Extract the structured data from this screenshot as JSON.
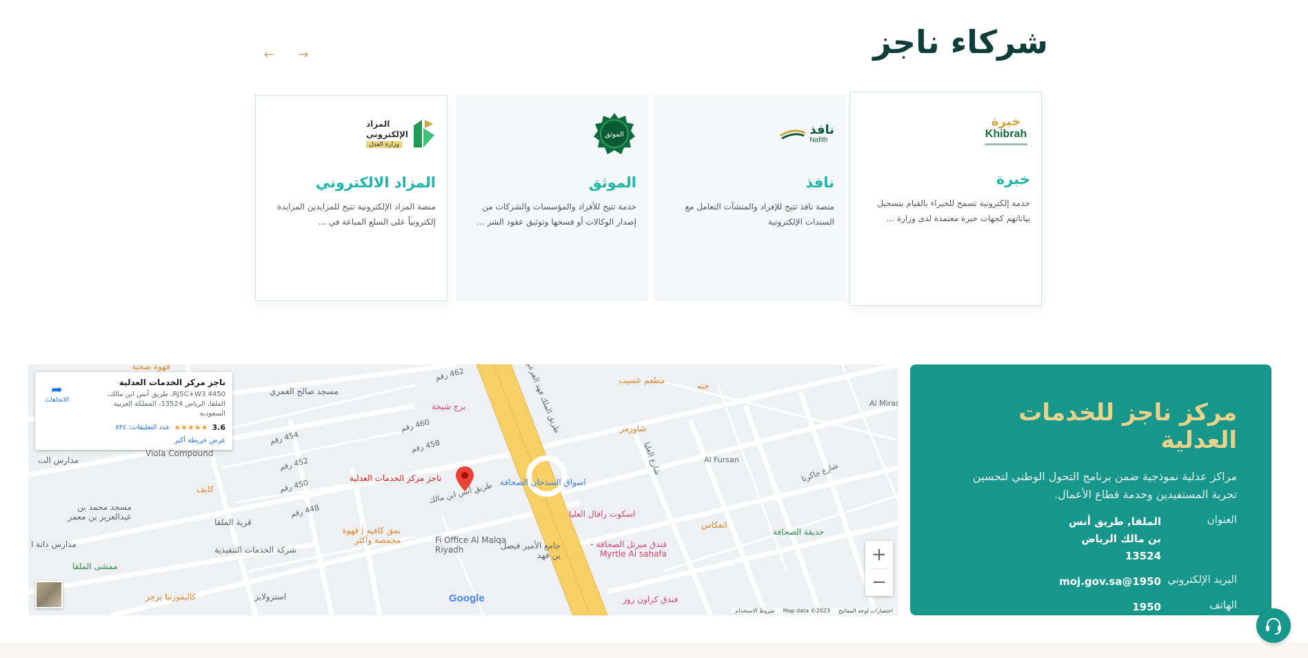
{
  "partners": {
    "title": "شركاء ناجز",
    "prev_arrow": "←",
    "next_arrow": "→",
    "cards": [
      {
        "name": "خبرة",
        "logo_ar": "خبرة",
        "logo_en": "Khibrah",
        "desc": "خدمة إلكترونية تسمح للخبراء بالقيام بتسجيل بياناتهم كجهات خبرة معتمدة لدى وزارة ..."
      },
      {
        "name": "نافذ",
        "logo_ar": "نافذ",
        "logo_en": "Nafith",
        "desc": "منصة نافذ تتيح للإفراد والمنشآت التعامل مع السندات الإلكترونية"
      },
      {
        "name": "الموثق",
        "logo_ar": "الموثق",
        "desc": "خدمة تتيح للأفراد والمؤسسات والشركات من إصدار الوكالات أو فسخها وتوثيق عقود الشر ..."
      },
      {
        "name": "المزاد الالكتروني",
        "logo_line1": "المزاد",
        "logo_line2": "الإلكتروني",
        "logo_line3": "وزارة العدل",
        "desc": "منصة المزاد الإلكترونية تتيح للمزايدين المزايدة إلكترونياً على السلع المباعة في ..."
      }
    ]
  },
  "map": {
    "info": {
      "name": "ناجز مركز الخدمات العدلية",
      "address": "4450 RJ5C+W3، طريق أنس ابن مالك، الملقا، الرياض 13524، المملكة العربية السعودية",
      "rating": "3.6",
      "stars": "★★★★★",
      "reviews": "عدد التعليقات: ٨٣٤",
      "larger_map": "عرض خريطة أكبر",
      "directions": "الاتجاهات"
    },
    "labels": {
      "qahwa_sohba": "قهوة صحبة",
      "masjid_saleh": "مسجد صالح العمري",
      "borj": "برج شيخة",
      "viola": "Viola Compound",
      "madaris": "مدارس الت",
      "kaif": "كايف",
      "masjid_mohammed": "مسجد محمد بن عبدالعزيز بن معمر",
      "qaryat": "قرية الملقا",
      "madaris_dana": "مدارس دانة ا",
      "mamsha": "ممشى الملقا",
      "california": "كاليفورنيا برجر",
      "estrolabe": "استرولابز",
      "tanfeethiya": "شركة الخدمات التنفيذية",
      "namaq": "نمق كافيه | قهوة محمصة وأكثر",
      "fi_office": "Fi Office Al Malqa Riyadh",
      "najiz_pin": "ناجز مركز الخدمات العدلية",
      "jamea": "جامع الأمير فيصل بن فهد",
      "aswaq": "اسواق السدحان الصحافة",
      "matam": "مطعم عسيب",
      "janna": "جنه",
      "shawarmar": "شاورمر",
      "escot": "اسكوت رافال العليا",
      "myrtle": "فندق ميرتل الصحافة - Myrtle Al sahafa",
      "crown": "فندق كراون روز",
      "inikas": "انعكاس",
      "hadiqa": "حديقة الصحافة",
      "al_fursan": "Al Fursan",
      "al_mirad": "Al Mirad",
      "anas_road": "طريق أنس ابن مالك",
      "fahd_road": "طريق الملك فهد الفرعي",
      "olaya": "شارع العليا",
      "jakarta": "شارع جاكرتا",
      "r462": "462 رقم",
      "r460": "460 رقم",
      "r458": "458 رقم",
      "r454": "454 رقم",
      "r452": "452 رقم",
      "r450": "450 رقم",
      "r448": "448 رقم"
    },
    "zoom_in": "+",
    "zoom_out": "−",
    "google": "Google",
    "footer": {
      "shortcuts": "اختصارات لوحة المفاتيح",
      "data": "Map data ©2023",
      "terms": "شروط الاستخدام"
    },
    "colors": {
      "main_road": "#f6cf65",
      "street": "#ffffff",
      "block": "#e8eaed"
    }
  },
  "center": {
    "title": "مركز ناجز للخدمات العدلية",
    "desc": "مراكز عدلية نموذجية ضمن برنامج التحول الوطني لتحسين تجربة المستفيدين وخدمة قطاع الأعمال.",
    "address_label": "العنوان",
    "address_value": "الملقا, طريق أنس بن مالك الرياض 13524",
    "email_label": "البريد الإلكتروني",
    "email_value": "1950@moj.gov.sa",
    "phone_label": "الهاتف",
    "phone_value": "1950",
    "bg_color": "#17968b",
    "title_color": "#e9d28c"
  },
  "chat": {
    "icon": "headset-icon"
  }
}
